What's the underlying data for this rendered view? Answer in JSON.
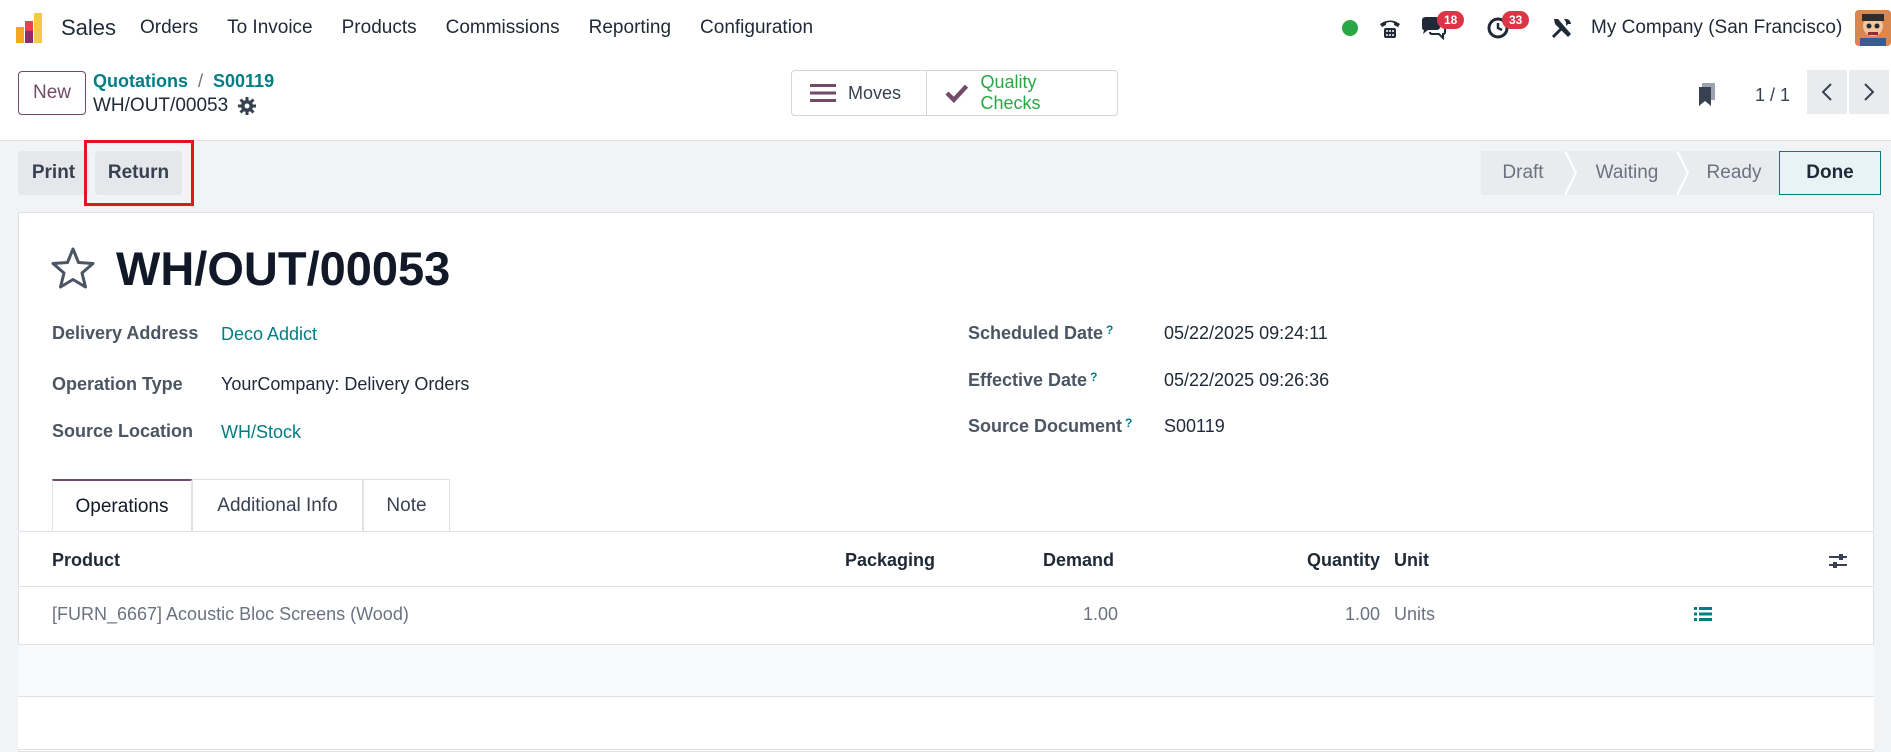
{
  "topbar": {
    "app_name": "Sales",
    "menu": [
      "Orders",
      "To Invoice",
      "Products",
      "Commissions",
      "Reporting",
      "Configuration"
    ],
    "messages_badge": "18",
    "activities_badge": "33",
    "company": "My Company (San Francisco)",
    "status_color": "#28a745"
  },
  "controlbar": {
    "new_label": "New",
    "breadcrumb": [
      "Quotations",
      "S00119"
    ],
    "breadcrumb_sep": "/",
    "record_name": "WH/OUT/00053",
    "smart_buttons": {
      "moves": "Moves",
      "quality_checks": "Quality Checks"
    },
    "pager": "1 / 1"
  },
  "actions": {
    "print": "Print",
    "return": "Return"
  },
  "status": [
    "Draft",
    "Waiting",
    "Ready",
    "Done"
  ],
  "record": {
    "title": "WH/OUT/00053",
    "fields_left": [
      {
        "label": "Delivery Address",
        "value": "Deco Addict"
      },
      {
        "label": "Operation Type",
        "value": "YourCompany: Delivery Orders"
      },
      {
        "label": "Source Location",
        "value": "WH/Stock"
      }
    ],
    "fields_right": [
      {
        "label": "Scheduled Date",
        "value": "05/22/2025 09:24:11"
      },
      {
        "label": "Effective Date",
        "value": "05/22/2025 09:26:36"
      },
      {
        "label": "Source Document",
        "value": "S00119"
      }
    ],
    "help_mark": "?"
  },
  "tabs": [
    "Operations",
    "Additional Info",
    "Note"
  ],
  "table": {
    "headers": {
      "product": "Product",
      "packaging": "Packaging",
      "demand": "Demand",
      "quantity": "Quantity",
      "unit": "Unit"
    },
    "rows": [
      {
        "product": "[FURN_6667] Acoustic Bloc Screens (Wood)",
        "packaging": "",
        "demand": "1.00",
        "quantity": "1.00",
        "unit": "Units"
      }
    ]
  }
}
